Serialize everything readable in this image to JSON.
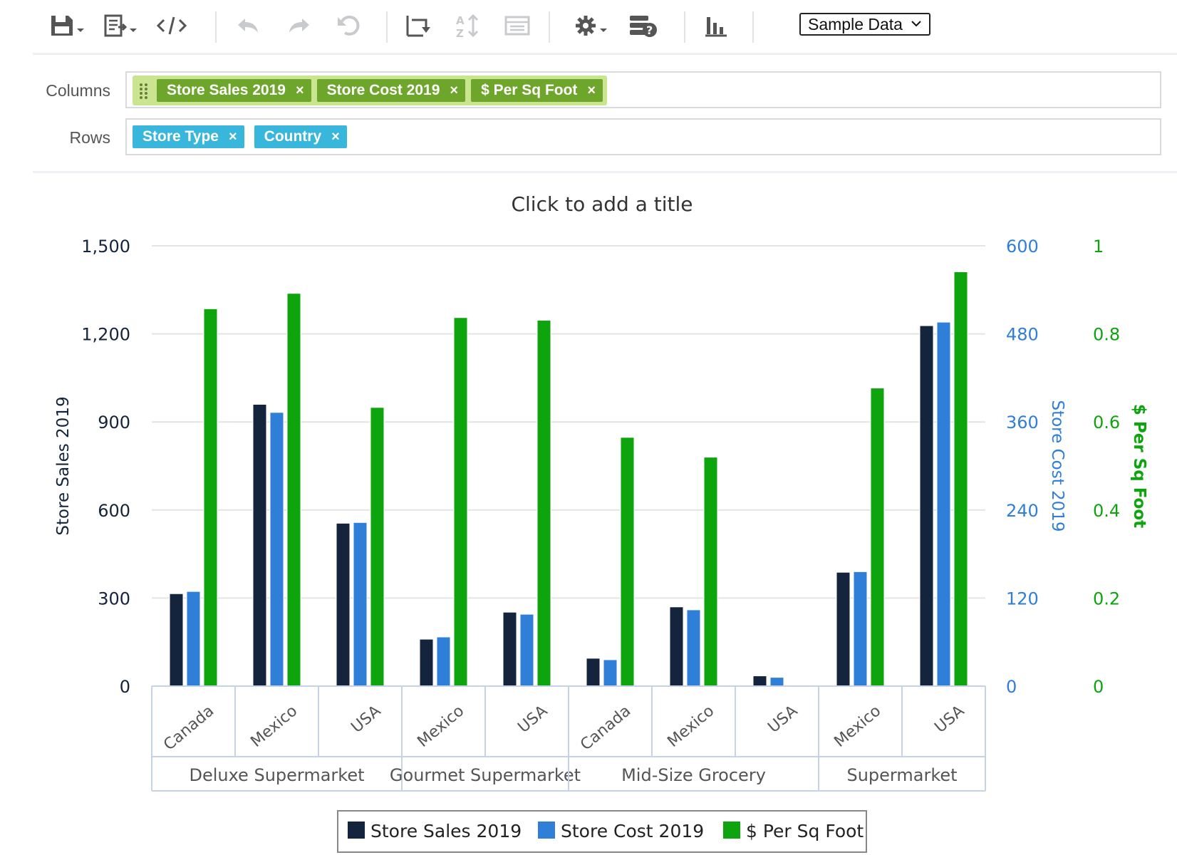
{
  "toolbar": {
    "buttons": [
      {
        "name": "save-icon",
        "dropdown": true
      },
      {
        "name": "export-icon",
        "dropdown": true
      },
      {
        "name": "code-icon",
        "dropdown": false
      },
      {
        "name": "undo-icon",
        "dropdown": false
      },
      {
        "name": "redo-icon",
        "dropdown": false
      },
      {
        "name": "reset-icon",
        "dropdown": false
      },
      {
        "name": "swap-axes-icon",
        "dropdown": false
      },
      {
        "name": "sort-icon",
        "dropdown": false
      },
      {
        "name": "table-view-icon",
        "dropdown": false
      },
      {
        "name": "settings-gear-icon",
        "dropdown": true
      },
      {
        "name": "data-source-help-icon",
        "dropdown": false
      },
      {
        "name": "chart-type-icon",
        "dropdown": false
      }
    ],
    "dataset_select": "Sample Data"
  },
  "fields": {
    "columns_label": "Columns",
    "rows_label": "Rows",
    "columns": [
      "Store Sales 2019",
      "Store Cost 2019",
      "$ Per Sq Foot"
    ],
    "rows": [
      "Store Type",
      "Country"
    ],
    "remove_glyph": "×"
  },
  "colors": {
    "store_sales": "#14243d",
    "store_cost": "#2f7ed8",
    "per_sq_foot": "#0da40d",
    "left_axis": "#14243d",
    "middle_axis": "#2f7ed8",
    "right_axis": "#0da40d",
    "pill_green": "#6ea62b",
    "pill_blue": "#38b6db"
  },
  "chart_data": {
    "type": "bar",
    "title": "Click to add a title",
    "groups": [
      {
        "name": "Deluxe Supermarket",
        "categories": [
          "Canada",
          "Mexico",
          "USA"
        ]
      },
      {
        "name": "Gourmet Supermarket",
        "categories": [
          "Mexico",
          "USA"
        ]
      },
      {
        "name": "Mid-Size Grocery",
        "categories": [
          "Canada",
          "Mexico",
          "USA"
        ]
      },
      {
        "name": "Supermarket",
        "categories": [
          "Mexico",
          "USA"
        ]
      }
    ],
    "series": [
      {
        "name": "Store Sales 2019",
        "axis": "left",
        "values": [
          315,
          960,
          555,
          160,
          252,
          95,
          270,
          35,
          388,
          1228
        ]
      },
      {
        "name": "Store Cost 2019",
        "axis": "middle",
        "values": [
          129,
          373,
          223,
          67,
          98,
          36,
          104,
          12,
          156,
          496
        ]
      },
      {
        "name": "$ Per Sq Foot",
        "axis": "right",
        "values": [
          0.857,
          0.892,
          0.633,
          0.837,
          0.831,
          0.565,
          0.52,
          0,
          0.677,
          0.941
        ]
      }
    ],
    "axes": {
      "left": {
        "title": "Store Sales 2019",
        "ticks": [
          "0",
          "300",
          "600",
          "900",
          "1,200",
          "1,500"
        ],
        "range": [
          0,
          1500
        ]
      },
      "middle": {
        "title": "Store Cost 2019",
        "ticks": [
          "0",
          "120",
          "240",
          "360",
          "480",
          "600"
        ],
        "range": [
          0,
          600
        ]
      },
      "right": {
        "title": "$ Per Sq Foot",
        "ticks": [
          "0",
          "0.2",
          "0.4",
          "0.6",
          "0.8",
          "1"
        ],
        "range": [
          0,
          1
        ]
      }
    },
    "grid": true,
    "legend": {
      "position": "bottom-center",
      "items": [
        "Store Sales 2019",
        "Store Cost 2019",
        "$ Per Sq Foot"
      ]
    }
  }
}
